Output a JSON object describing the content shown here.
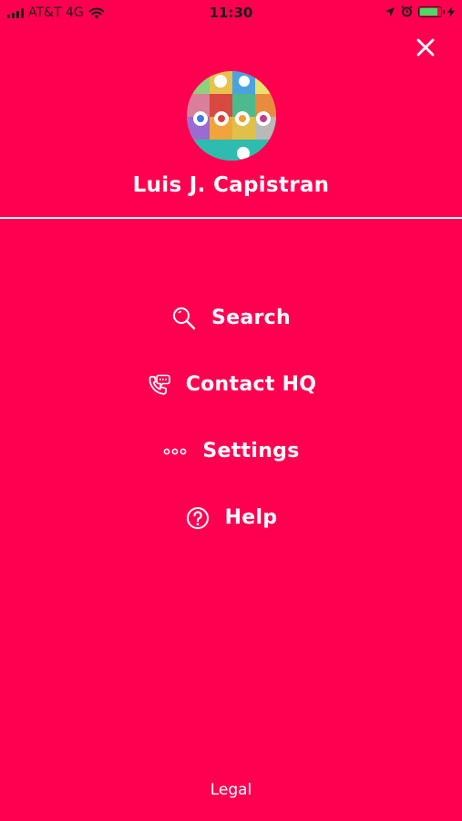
{
  "status_bar": {
    "carrier": "AT&T 4G",
    "time": "11:30",
    "battery_level": 0.85
  },
  "colors": {
    "background": "#ff0050",
    "text": "#ffffff",
    "battery": "#4cd964"
  },
  "profile": {
    "name": "Luis J. Capistran"
  },
  "menu": {
    "items": [
      {
        "label": "Search",
        "icon": "search-icon"
      },
      {
        "label": "Contact HQ",
        "icon": "phone-chat-icon"
      },
      {
        "label": "Settings",
        "icon": "dots-icon"
      },
      {
        "label": "Help",
        "icon": "question-circle-icon"
      }
    ]
  },
  "footer": {
    "legal_label": "Legal"
  }
}
